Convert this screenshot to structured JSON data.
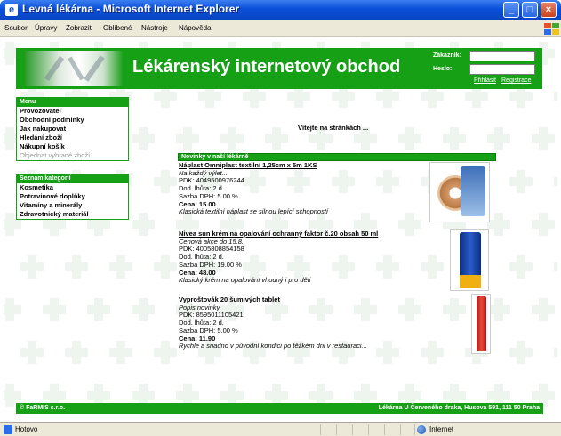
{
  "window": {
    "title": "Levná lékárna - Microsoft Internet Explorer"
  },
  "menubar": {
    "items": [
      "Soubor",
      "Úpravy",
      "Zobrazit",
      "Oblíbené",
      "Nástroje",
      "Nápověda"
    ]
  },
  "site": {
    "name": "Lékárenský internetový obchod",
    "login": {
      "customer_label": "Zákazník:",
      "password_label": "Heslo:",
      "login_link": "Přihlásit",
      "register_link": "Registrace"
    },
    "welcome": "Vítejte na stránkách ...",
    "menu": {
      "header": "Menu",
      "items": [
        "Provozovatel",
        "Obchodní podmínky",
        "Jak nakupovat",
        "Hledání zboží",
        "Nákupní košík"
      ],
      "disabled_item": "Objednat vybrané zboží"
    },
    "categories": {
      "header": "Seznam kategorií",
      "items": [
        "Kosmetika",
        "Potravinové doplňky",
        "Vitamíny a minerály",
        "Zdravotnický materiál"
      ]
    },
    "news": {
      "header": "Novinky v naší lékárně",
      "products": [
        {
          "name": "Náplast Omniplast textilní 1,25cm x 5m 1KS",
          "note": "Na každý výlet...",
          "pdk": "PDK: 4049500976244",
          "delivery": "Dod. lhůta: 2 d.",
          "vat": "Sazba DPH: 5.00 %",
          "price": "Cena: 15.00",
          "desc": "Klasická textilní náplast se silnou lepící schopností"
        },
        {
          "name": "Nivea sun krém na opalování ochranný faktor č.20 obsah 50 ml",
          "note": "Cenová akce do 15.8.",
          "pdk": "PDK: 4005808854158",
          "delivery": "Dod. lhůta: 2 d.",
          "vat": "Sazba DPH: 19.00 %",
          "price": "Cena: 48.00",
          "desc": "Klasický krém na opalování vhodný i pro děti"
        },
        {
          "name": "Vyproštovák 20 šumivých tablet",
          "note": "Popis novinky",
          "pdk": "PDK: 8595011105421",
          "delivery": "Dod. lhůta: 2 d.",
          "vat": "Sazba DPH: 5.00 %",
          "price": "Cena: 11.90",
          "desc": "Rychle a snadno v původní kondici po těžkém dni v restauraci..."
        }
      ]
    },
    "footer": {
      "left": "© FaRMIS s.r.o.",
      "right": "Lékárna U Červeného draka, Husova 591, 111 50 Praha"
    }
  },
  "status": {
    "text": "Hotovo",
    "zone": "Internet"
  },
  "colors": {
    "brand_green": "#16a016",
    "xp_blue": "#0a4fd8"
  }
}
